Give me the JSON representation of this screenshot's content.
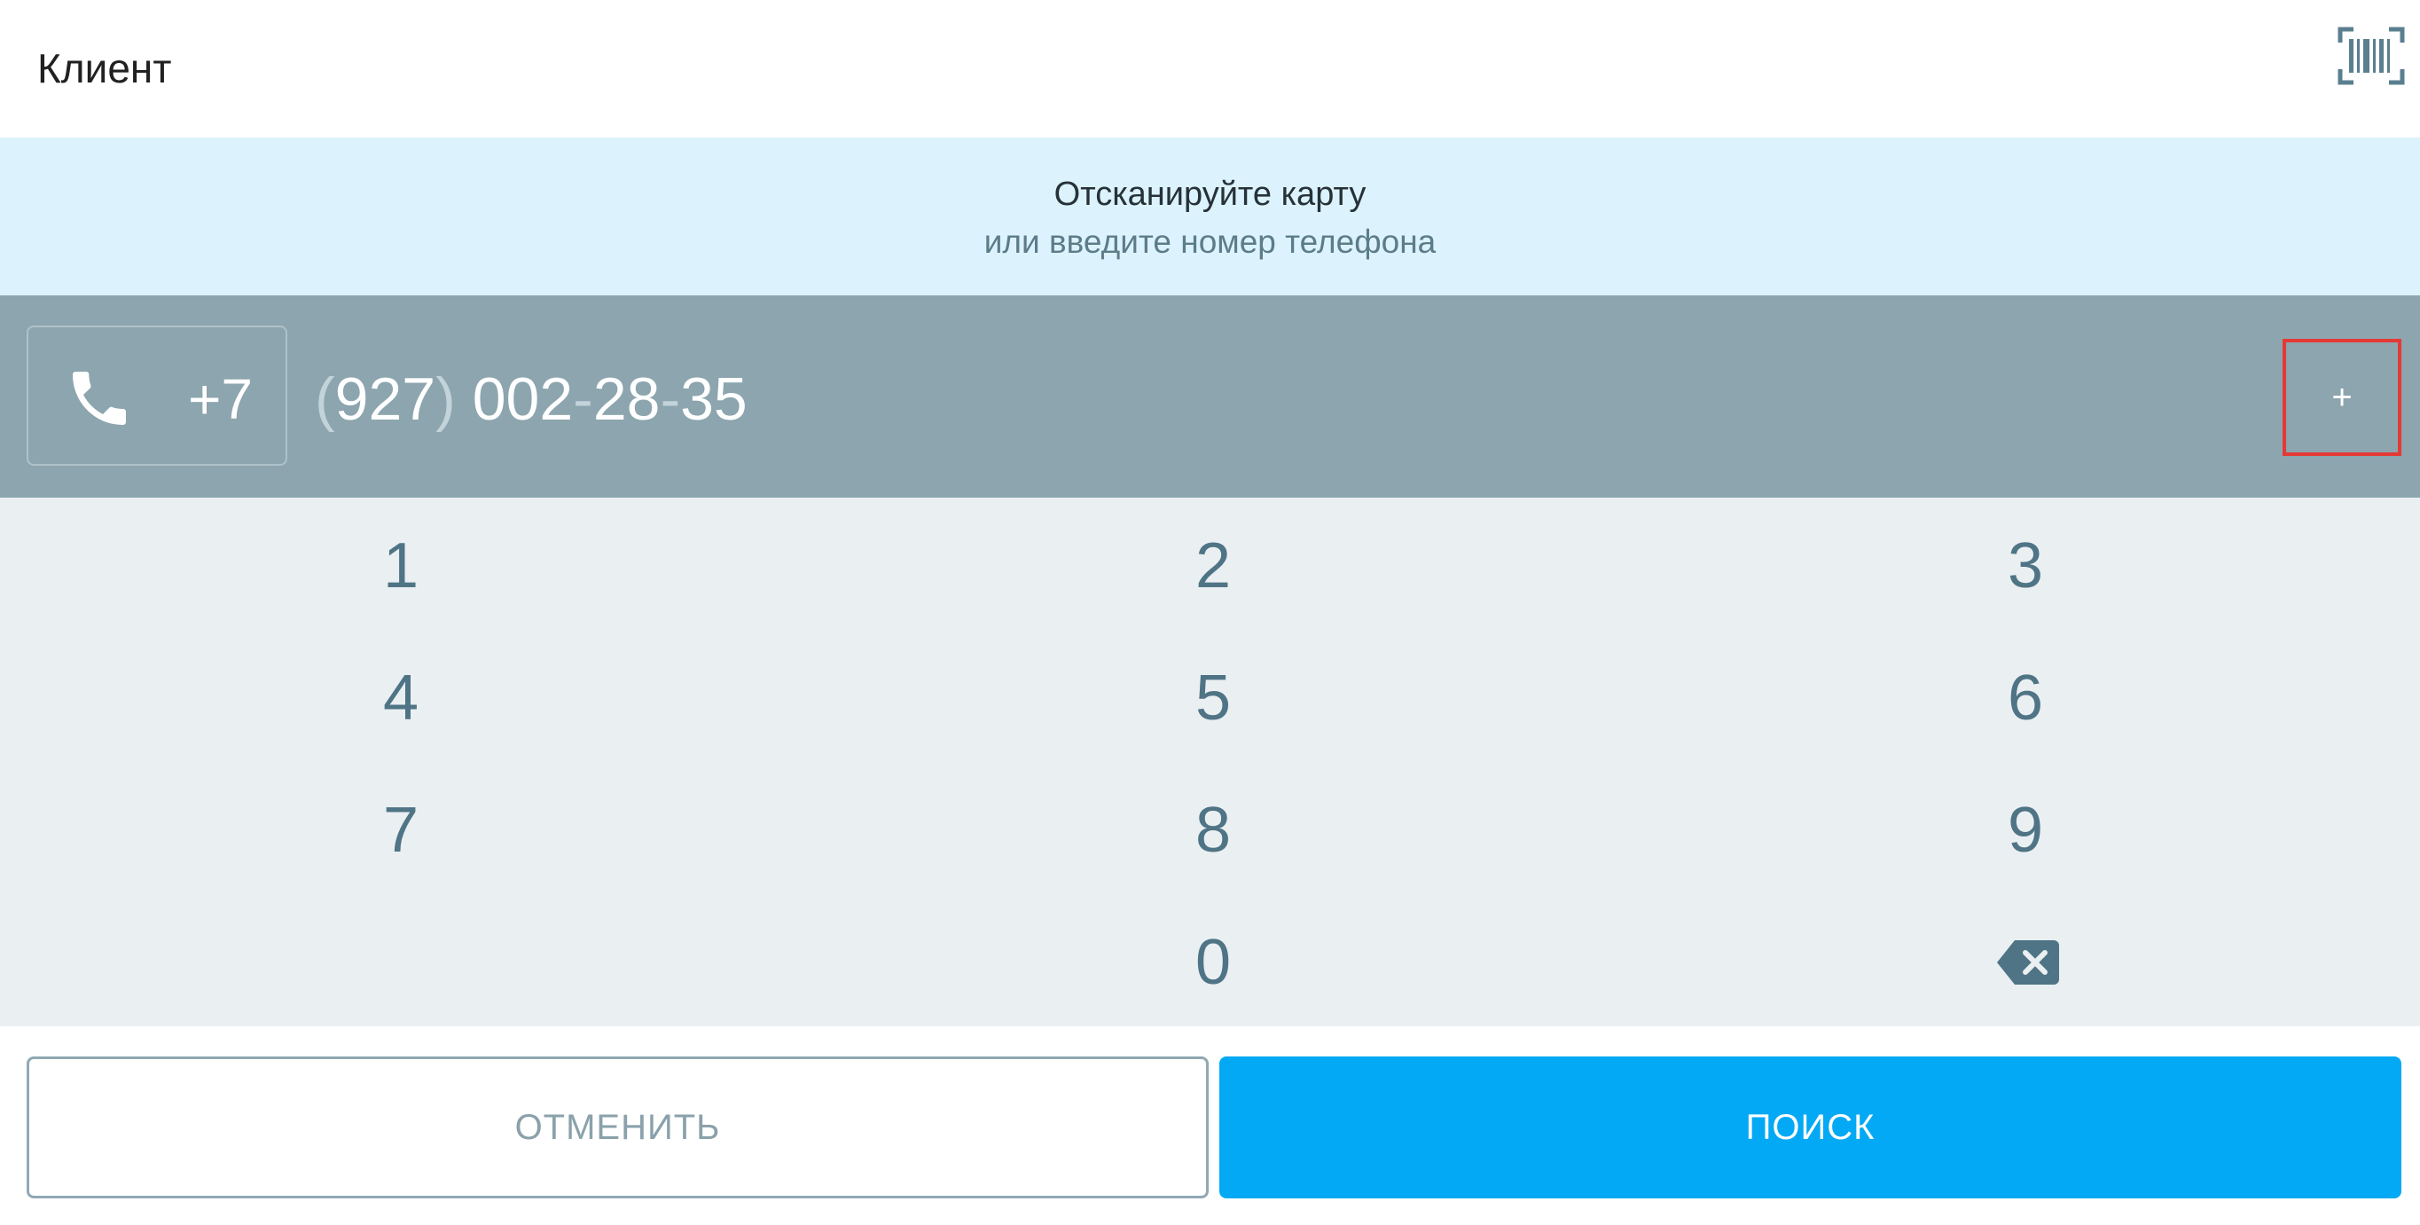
{
  "header": {
    "title": "Клиент",
    "scan_icon": "barcode-scan-icon"
  },
  "banner": {
    "title": "Отсканируйте карту",
    "subtitle": "или введите номер телефона"
  },
  "phone": {
    "icon": "phone-icon",
    "country_code": "+7",
    "open_paren": "(",
    "area_code": "927",
    "close_paren": ")",
    "part1": "002",
    "dash1": "-",
    "part2": "28",
    "dash2": "-",
    "part3": "35",
    "add_label": "+"
  },
  "keypad": {
    "keys": [
      "1",
      "2",
      "3",
      "4",
      "5",
      "6",
      "7",
      "8",
      "9",
      "0"
    ],
    "backspace_icon": "backspace-icon"
  },
  "actions": {
    "cancel_label": "ОТМЕНИТЬ",
    "search_label": "ПОИСК"
  },
  "colors": {
    "accent": "#03a9f4",
    "banner": "#dcf3fd",
    "phone_bar": "#8ca5ae",
    "keypad_bg": "#eaeff2",
    "key_text": "#4f7485",
    "highlight": "#e53935"
  }
}
